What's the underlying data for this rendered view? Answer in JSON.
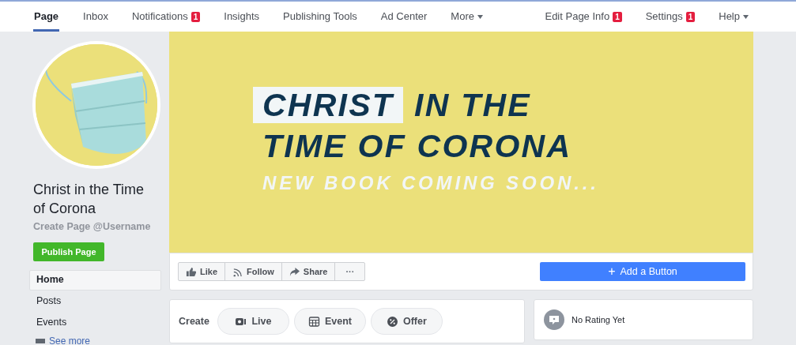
{
  "nav": {
    "left": [
      {
        "label": "Page",
        "selected": true
      },
      {
        "label": "Inbox",
        "selected": false
      },
      {
        "label": "Notifications",
        "selected": false,
        "badge": "1"
      },
      {
        "label": "Insights",
        "selected": false
      },
      {
        "label": "Publishing Tools",
        "selected": false
      },
      {
        "label": "Ad Center",
        "selected": false
      },
      {
        "label": "More",
        "selected": false,
        "caret": true
      }
    ],
    "right": [
      {
        "label": "Edit Page Info",
        "selected": false,
        "badge": "1"
      },
      {
        "label": "Settings",
        "selected": false,
        "badge": "1"
      },
      {
        "label": "Help",
        "selected": false,
        "caret": true
      }
    ]
  },
  "profile": {
    "name": "Christ in the Time of Corona",
    "username": "Create Page @Username",
    "publish_button": "Publish Page"
  },
  "menu": [
    {
      "label": "Home",
      "selected": true
    },
    {
      "label": "Posts",
      "selected": false
    },
    {
      "label": "Events",
      "selected": false
    }
  ],
  "see_more": "See more",
  "cover": {
    "highlight": "CHRIST",
    "title_rest": "IN THE",
    "title_line2": "TIME OF CORONA",
    "subtitle": "NEW BOOK COMING SOON..."
  },
  "actions": [
    {
      "kind": "like",
      "label": "Like"
    },
    {
      "kind": "follow",
      "label": "Follow"
    },
    {
      "kind": "share",
      "label": "Share"
    },
    {
      "kind": "more",
      "label": "···"
    }
  ],
  "add_button": {
    "icon": "+",
    "label": "Add a Button"
  },
  "create": {
    "label": "Create",
    "items": [
      {
        "kind": "live",
        "label": "Live"
      },
      {
        "kind": "event",
        "label": "Event"
      },
      {
        "kind": "offer",
        "label": "Offer"
      }
    ]
  },
  "rating": {
    "text": "No Rating Yet"
  }
}
